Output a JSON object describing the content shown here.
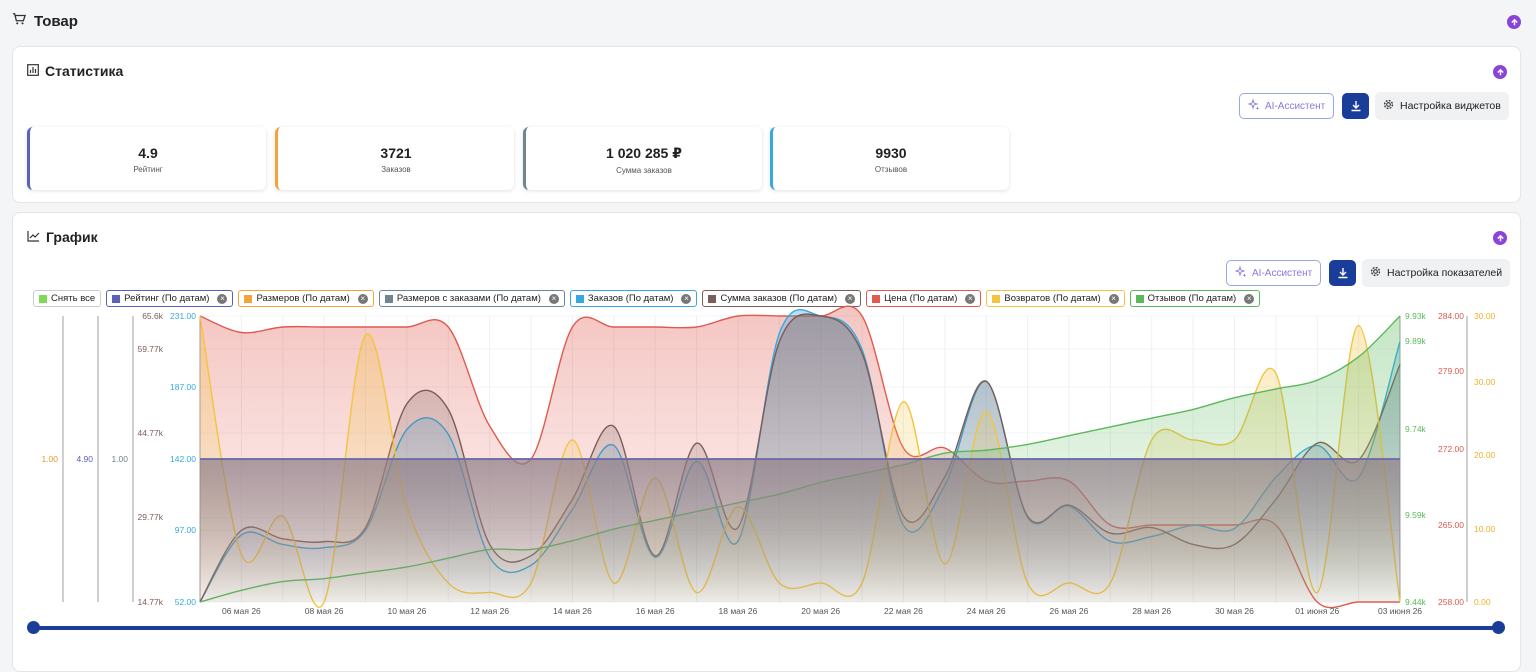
{
  "header": {
    "title": "Товар"
  },
  "stats": {
    "title": "Статистика",
    "ai_label": "AI-Ассистент",
    "settings_label": "Настройка виджетов",
    "kpis": [
      {
        "value": "4.9",
        "label": "Рейтинг",
        "color": "#5a63b8"
      },
      {
        "value": "3721",
        "label": "Заказов",
        "color": "#f2a33a"
      },
      {
        "value": "1 020 285 ₽",
        "label": "Сумма заказов",
        "color": "#6f8592"
      },
      {
        "value": "9930",
        "label": "Отзывов",
        "color": "#36a9e1"
      }
    ]
  },
  "graph": {
    "title": "График",
    "ai_label": "AI-Ассистент",
    "settings_label": "Настройка показателей",
    "legend": [
      {
        "label": "Снять все",
        "color": "#7ed957",
        "closable": false
      },
      {
        "label": "Рейтинг (По датам)",
        "color": "#5a63b8",
        "closable": true
      },
      {
        "label": "Размеров (По датам)",
        "color": "#f2a33a",
        "closable": true
      },
      {
        "label": "Размеров с заказами (По датам)",
        "color": "#6f8592",
        "closable": true
      },
      {
        "label": "Заказов (По датам)",
        "color": "#36a9e1",
        "closable": true
      },
      {
        "label": "Сумма заказов (По датам)",
        "color": "#7a5c58",
        "closable": true
      },
      {
        "label": "Цена (По датам)",
        "color": "#e05a4e",
        "closable": true
      },
      {
        "label": "Возвратов (По датам)",
        "color": "#f3c440",
        "closable": true
      },
      {
        "label": "Отзывов (По датам)",
        "color": "#5cb85c",
        "closable": true
      }
    ],
    "left_single_ticks": [
      {
        "text": "1.00",
        "color": "#e89a2c"
      },
      {
        "text": "4.90",
        "color": "#5a63b8"
      },
      {
        "text": "1.00",
        "color": "#6f8592"
      }
    ],
    "left_axis_sum": {
      "color": "#7a5c58",
      "ticks": [
        "65.6k",
        "59.77k",
        "44.77k",
        "29.77k",
        "14.77k"
      ]
    },
    "left_axis_orders": {
      "color": "#36a9e1",
      "ticks": [
        "231.00",
        "187.00",
        "142.00",
        "97.00",
        "52.00"
      ]
    },
    "right_axis_reviews": {
      "color": "#5cb85c",
      "ticks": [
        "9.93k",
        "9.89k",
        "9.74k",
        "9.59k",
        "9.44k"
      ]
    },
    "right_axis_price": {
      "color": "#e05a4e",
      "ticks": [
        "284.00",
        "279.00",
        "272.00",
        "265.00",
        "258.00"
      ]
    },
    "right_axis_returns": {
      "color": "#f3b02a",
      "ticks": [
        "30.00",
        "30.00",
        "20.00",
        "10.00",
        "0.00"
      ]
    },
    "x_labels": [
      "06 мая 26",
      "08 мая 26",
      "10 мая 26",
      "12 мая 26",
      "14 мая 26",
      "16 мая 26",
      "18 мая 26",
      "20 мая 26",
      "22 мая 26",
      "24 мая 26",
      "26 мая 26",
      "28 мая 26",
      "30 мая 26",
      "01 июня 26",
      "03 июня 26"
    ]
  },
  "chart_data": {
    "type": "line",
    "x": [
      "05 мая 26",
      "06 мая 26",
      "07 мая 26",
      "08 мая 26",
      "09 мая 26",
      "10 мая 26",
      "11 мая 26",
      "12 мая 26",
      "13 мая 26",
      "14 мая 26",
      "15 мая 26",
      "16 мая 26",
      "17 мая 26",
      "18 мая 26",
      "19 мая 26",
      "20 мая 26",
      "21 мая 26",
      "22 мая 26",
      "23 мая 26",
      "24 мая 26",
      "25 мая 26",
      "26 мая 26",
      "27 мая 26",
      "28 мая 26",
      "29 мая 26",
      "30 мая 26",
      "31 мая 26",
      "01 июня 26",
      "02 июня 26",
      "03 июня 26"
    ],
    "series": [
      {
        "name": "Рейтинг (По датам)",
        "color": "#5a63b8",
        "values": [
          4.9,
          4.9,
          4.9,
          4.9,
          4.9,
          4.9,
          4.9,
          4.9,
          4.9,
          4.9,
          4.9,
          4.9,
          4.9,
          4.9,
          4.9,
          4.9,
          4.9,
          4.9,
          4.9,
          4.9,
          4.9,
          4.9,
          4.9,
          4.9,
          4.9,
          4.9,
          4.9,
          4.9,
          4.9,
          4.9
        ]
      },
      {
        "name": "Размеров (По датам)",
        "color": "#f2a33a",
        "values": [
          1,
          1,
          1,
          1,
          1,
          1,
          1,
          1,
          1,
          1,
          1,
          1,
          1,
          1,
          1,
          1,
          1,
          1,
          1,
          1,
          1,
          1,
          1,
          1,
          1,
          1,
          1,
          1,
          1,
          1
        ]
      },
      {
        "name": "Размеров с заказами (По датам)",
        "color": "#6f8592",
        "values": [
          1,
          1,
          1,
          1,
          1,
          1,
          1,
          1,
          1,
          1,
          1,
          1,
          1,
          1,
          1,
          1,
          1,
          1,
          1,
          1,
          1,
          1,
          1,
          1,
          1,
          1,
          1,
          1,
          1,
          1
        ]
      },
      {
        "name": "Заказов (По датам)",
        "color": "#36a9e1",
        "values": [
          52,
          94,
          88,
          86,
          97,
          160,
          157,
          80,
          75,
          110,
          150,
          80,
          140,
          90,
          220,
          231,
          210,
          100,
          125,
          190,
          105,
          112,
          90,
          93,
          100,
          98,
          130,
          150,
          130,
          215
        ]
      },
      {
        "name": "Сумма заказов (По датам)",
        "color": "#7a5c58",
        "values": [
          14800,
          27500,
          26000,
          25500,
          28000,
          50000,
          49000,
          25000,
          23000,
          33000,
          46000,
          23000,
          43000,
          28000,
          61000,
          65600,
          59000,
          30000,
          37000,
          54000,
          30000,
          32000,
          27000,
          28000,
          25000,
          25000,
          33000,
          43000,
          40000,
          57000
        ]
      },
      {
        "name": "Цена (По датам)",
        "color": "#e05a4e",
        "values": [
          284,
          282.5,
          283,
          283,
          283,
          283,
          283,
          274,
          271,
          283,
          283,
          283,
          283,
          284,
          284,
          284,
          284,
          272,
          272,
          269,
          269,
          269,
          265,
          265,
          265,
          265,
          265,
          258,
          258,
          258
        ]
      },
      {
        "name": "Возвратов (По датам)",
        "color": "#f3c440",
        "values": [
          30,
          5,
          9,
          0,
          28,
          10,
          2,
          1,
          2,
          17,
          2,
          13,
          1,
          10,
          2,
          2,
          2,
          21,
          4,
          20,
          2,
          2,
          2,
          17,
          17,
          17,
          24,
          1,
          29,
          0
        ]
      },
      {
        "name": "Отзывов (По датам)",
        "color": "#5cb85c",
        "values": [
          9440,
          9460,
          9475,
          9480,
          9490,
          9500,
          9515,
          9530,
          9530,
          9545,
          9565,
          9580,
          9595,
          9610,
          9625,
          9645,
          9660,
          9675,
          9695,
          9700,
          9710,
          9725,
          9740,
          9755,
          9770,
          9790,
          9805,
          9820,
          9860,
          9930
        ]
      }
    ]
  }
}
